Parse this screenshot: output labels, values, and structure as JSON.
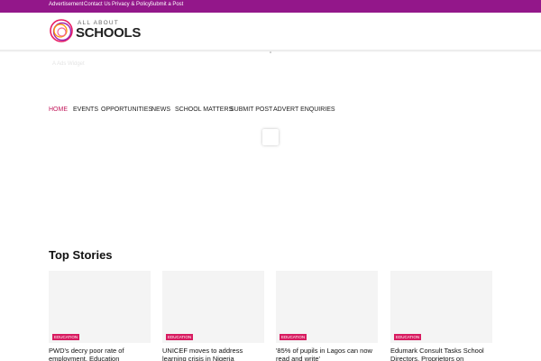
{
  "topbar": {
    "links": [
      "Advertisement",
      "Contact Us",
      "Privacy & Policy",
      "Submit a Post"
    ],
    "color": "#93178a"
  },
  "logo": {
    "line1": "ALL ABOUT",
    "line2": "SCHOOLS"
  },
  "ghost_text": "A   Ads  Widget",
  "nav": {
    "items": [
      "HOME",
      "EVENTS",
      "OPPORTUNITIES",
      "NEWS",
      "SCHOOL MATTERS",
      "SUBMIT POST",
      "ADVERT ENQUIRIES"
    ],
    "active": "HOME",
    "active_color": "#c2185b"
  },
  "top_stories": {
    "title": "Top Stories",
    "cards": [
      {
        "tag": "EDUCATION",
        "headline": "PWD's decry poor rate of employment, Education"
      },
      {
        "tag": "EDUCATION",
        "headline": "UNICEF moves to address learning crisis in Nigeria"
      },
      {
        "tag": "EDUCATION",
        "headline": "'85% of pupils in Lagos can now read and write'"
      },
      {
        "tag": "EDUCATION",
        "headline": "Edumark Consult Tasks School Directors, Proprietors on"
      }
    ],
    "tag_color": "#d81b60"
  }
}
